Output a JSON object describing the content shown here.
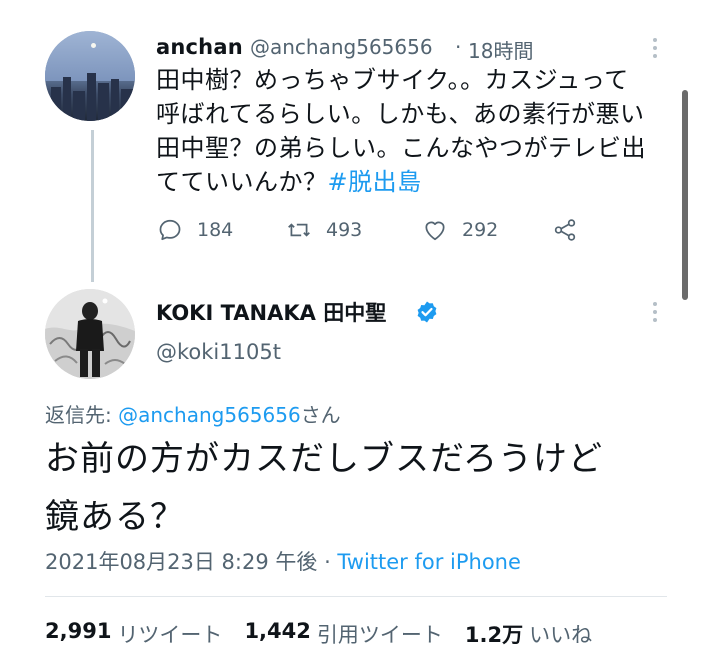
{
  "parent_tweet": {
    "name": "anchan",
    "handle": "@anchang565656",
    "separator": "·",
    "time": "18時間",
    "text_lines": [
      "田中樹？めっちゃブサイク。。カスジュって",
      "呼ばれてるらしい。しかも、あの素行が悪い",
      "田中聖？の弟らしい。こんなやつがテレビ出",
      "てていいんか？"
    ],
    "hashtag": "#脱出島",
    "reply_count": "184",
    "retweet_count": "493",
    "like_count": "292"
  },
  "main_tweet": {
    "name": "KOKI TANAKA 田中聖",
    "handle": "@koki1105t",
    "replying_prefix": "返信先: ",
    "replying_mention": "@anchang565656",
    "replying_suffix": "さん",
    "text_line1": "お前の方がカスだしブスだろうけど",
    "text_line2": "鏡ある？",
    "timestamp": "2021年08月23日 8:29 午後 · ",
    "source": "Twitter for iPhone",
    "stats": [
      {
        "number": "2,991",
        "label": "リツイート"
      },
      {
        "number": "1,442",
        "label": "引用ツイート"
      },
      {
        "number": "1.2万",
        "label": "いいね"
      }
    ]
  },
  "icons": {
    "reply": "reply-icon",
    "retweet": "retweet-icon",
    "like": "like-icon",
    "share": "share-icon",
    "verified": "verified-badge-icon",
    "more": "more-vertical-icon"
  },
  "colors": {
    "link": "#1d9bf0",
    "secondary_text": "#536471",
    "primary_text": "#0f1419",
    "verified": "#1d9bf0"
  }
}
